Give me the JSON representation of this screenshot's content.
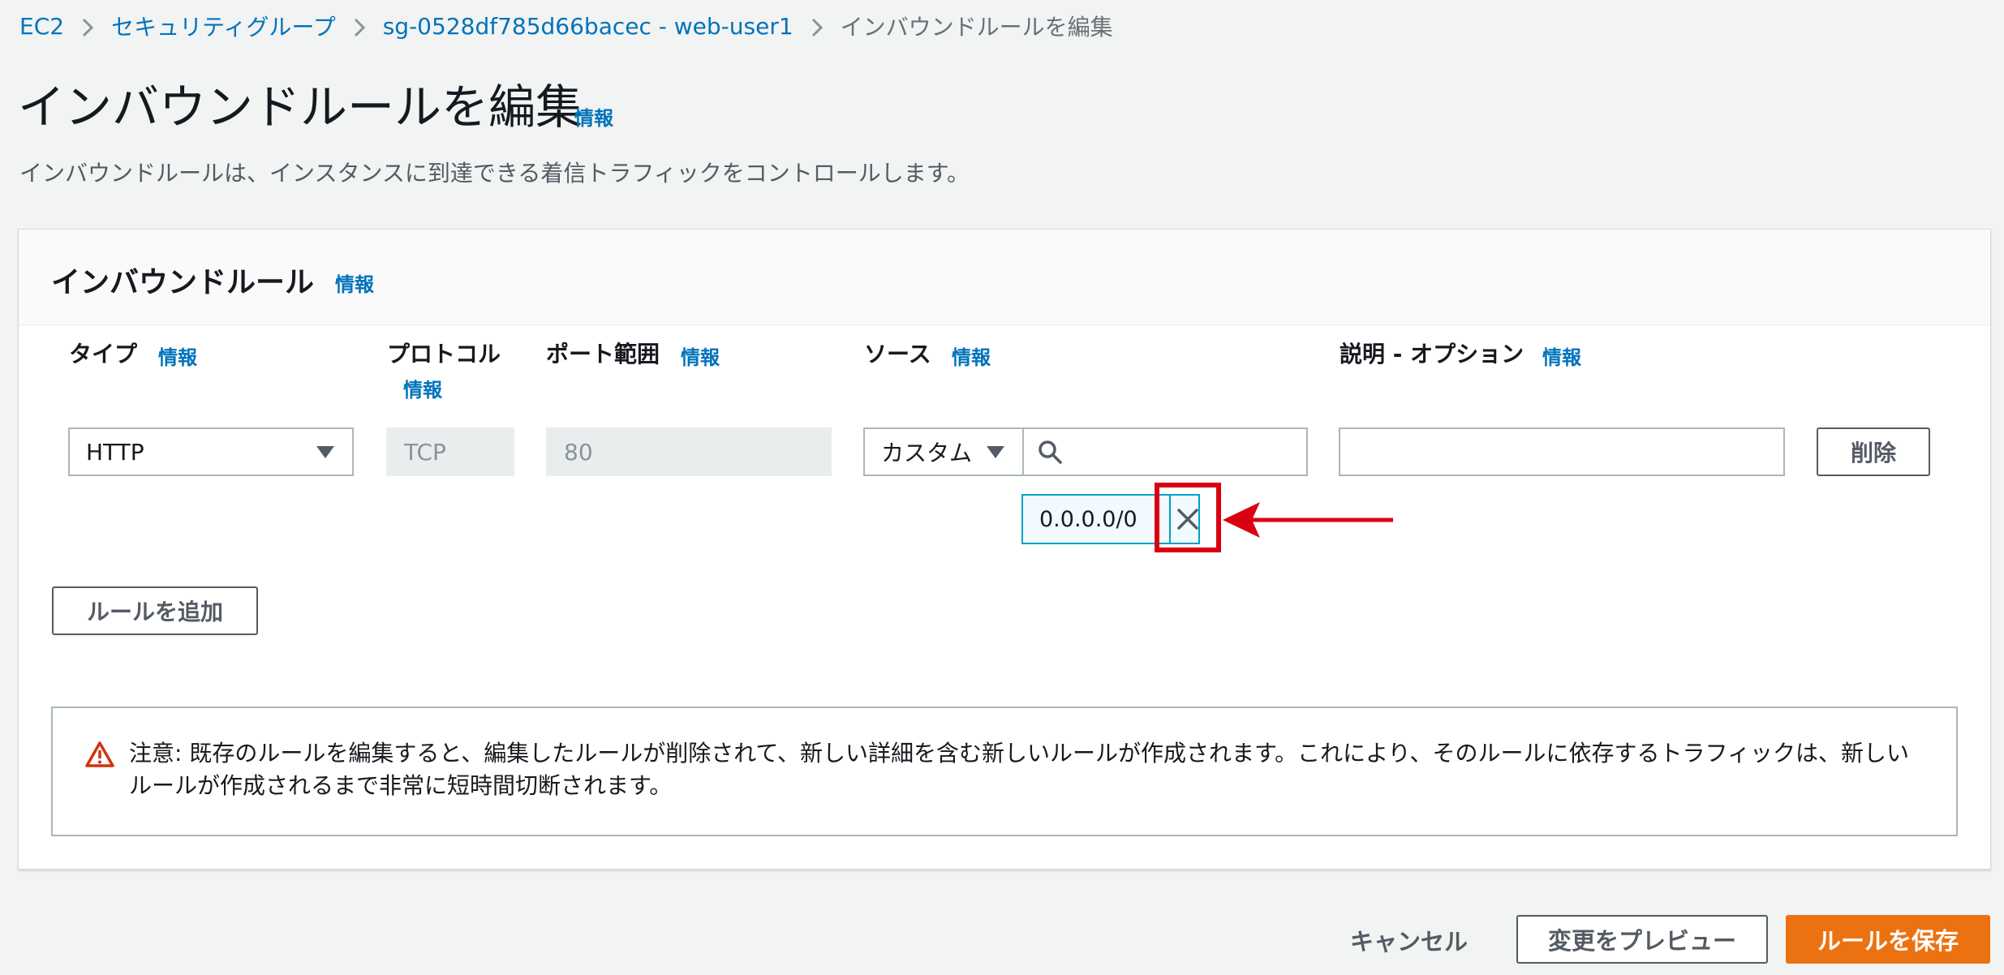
{
  "breadcrumb": {
    "items": [
      "EC2",
      "セキュリティグループ",
      "sg-0528df785d66bacec - web-user1",
      "インバウンドルールを編集"
    ]
  },
  "page": {
    "title": "インバウンドルールを編集",
    "info_link": "情報",
    "description": "インバウンドルールは、インスタンスに到達できる着信トラフィックをコントロールします。"
  },
  "panel": {
    "title": "インバウンドルール",
    "info_link": "情報",
    "columns": {
      "type": "タイプ",
      "protocol": "プロトコル",
      "port_range": "ポート範囲",
      "source": "ソース",
      "description": "説明 - オプション",
      "info": "情報"
    },
    "rule": {
      "type": "HTTP",
      "protocol": "TCP",
      "port_range": "80",
      "source_mode": "カスタム",
      "source_search_value": "",
      "cidr_token": "0.0.0.0/0",
      "description_value": "",
      "delete_label": "削除"
    },
    "add_rule_label": "ルールを追加",
    "warning": "注意: 既存のルールを編集すると、編集したルールが削除されて、新しい詳細を含む新しいルールが作成されます。これにより、そのルールに依存するトラフィックは、新しいルールが作成されるまで非常に短時間切断されます。"
  },
  "footer": {
    "cancel_label": "キャンセル",
    "preview_label": "変更をプレビュー",
    "save_label": "ルールを保存"
  },
  "colors": {
    "link": "#0073bb",
    "primary": "#ec7211",
    "annotation": "#d90012",
    "warning_icon": "#d13212",
    "token_border": "#00a1c9"
  },
  "icons": [
    "chevron-right-icon",
    "caret-down-icon",
    "search-icon",
    "close-icon",
    "warning-icon",
    "annotation-arrow"
  ]
}
